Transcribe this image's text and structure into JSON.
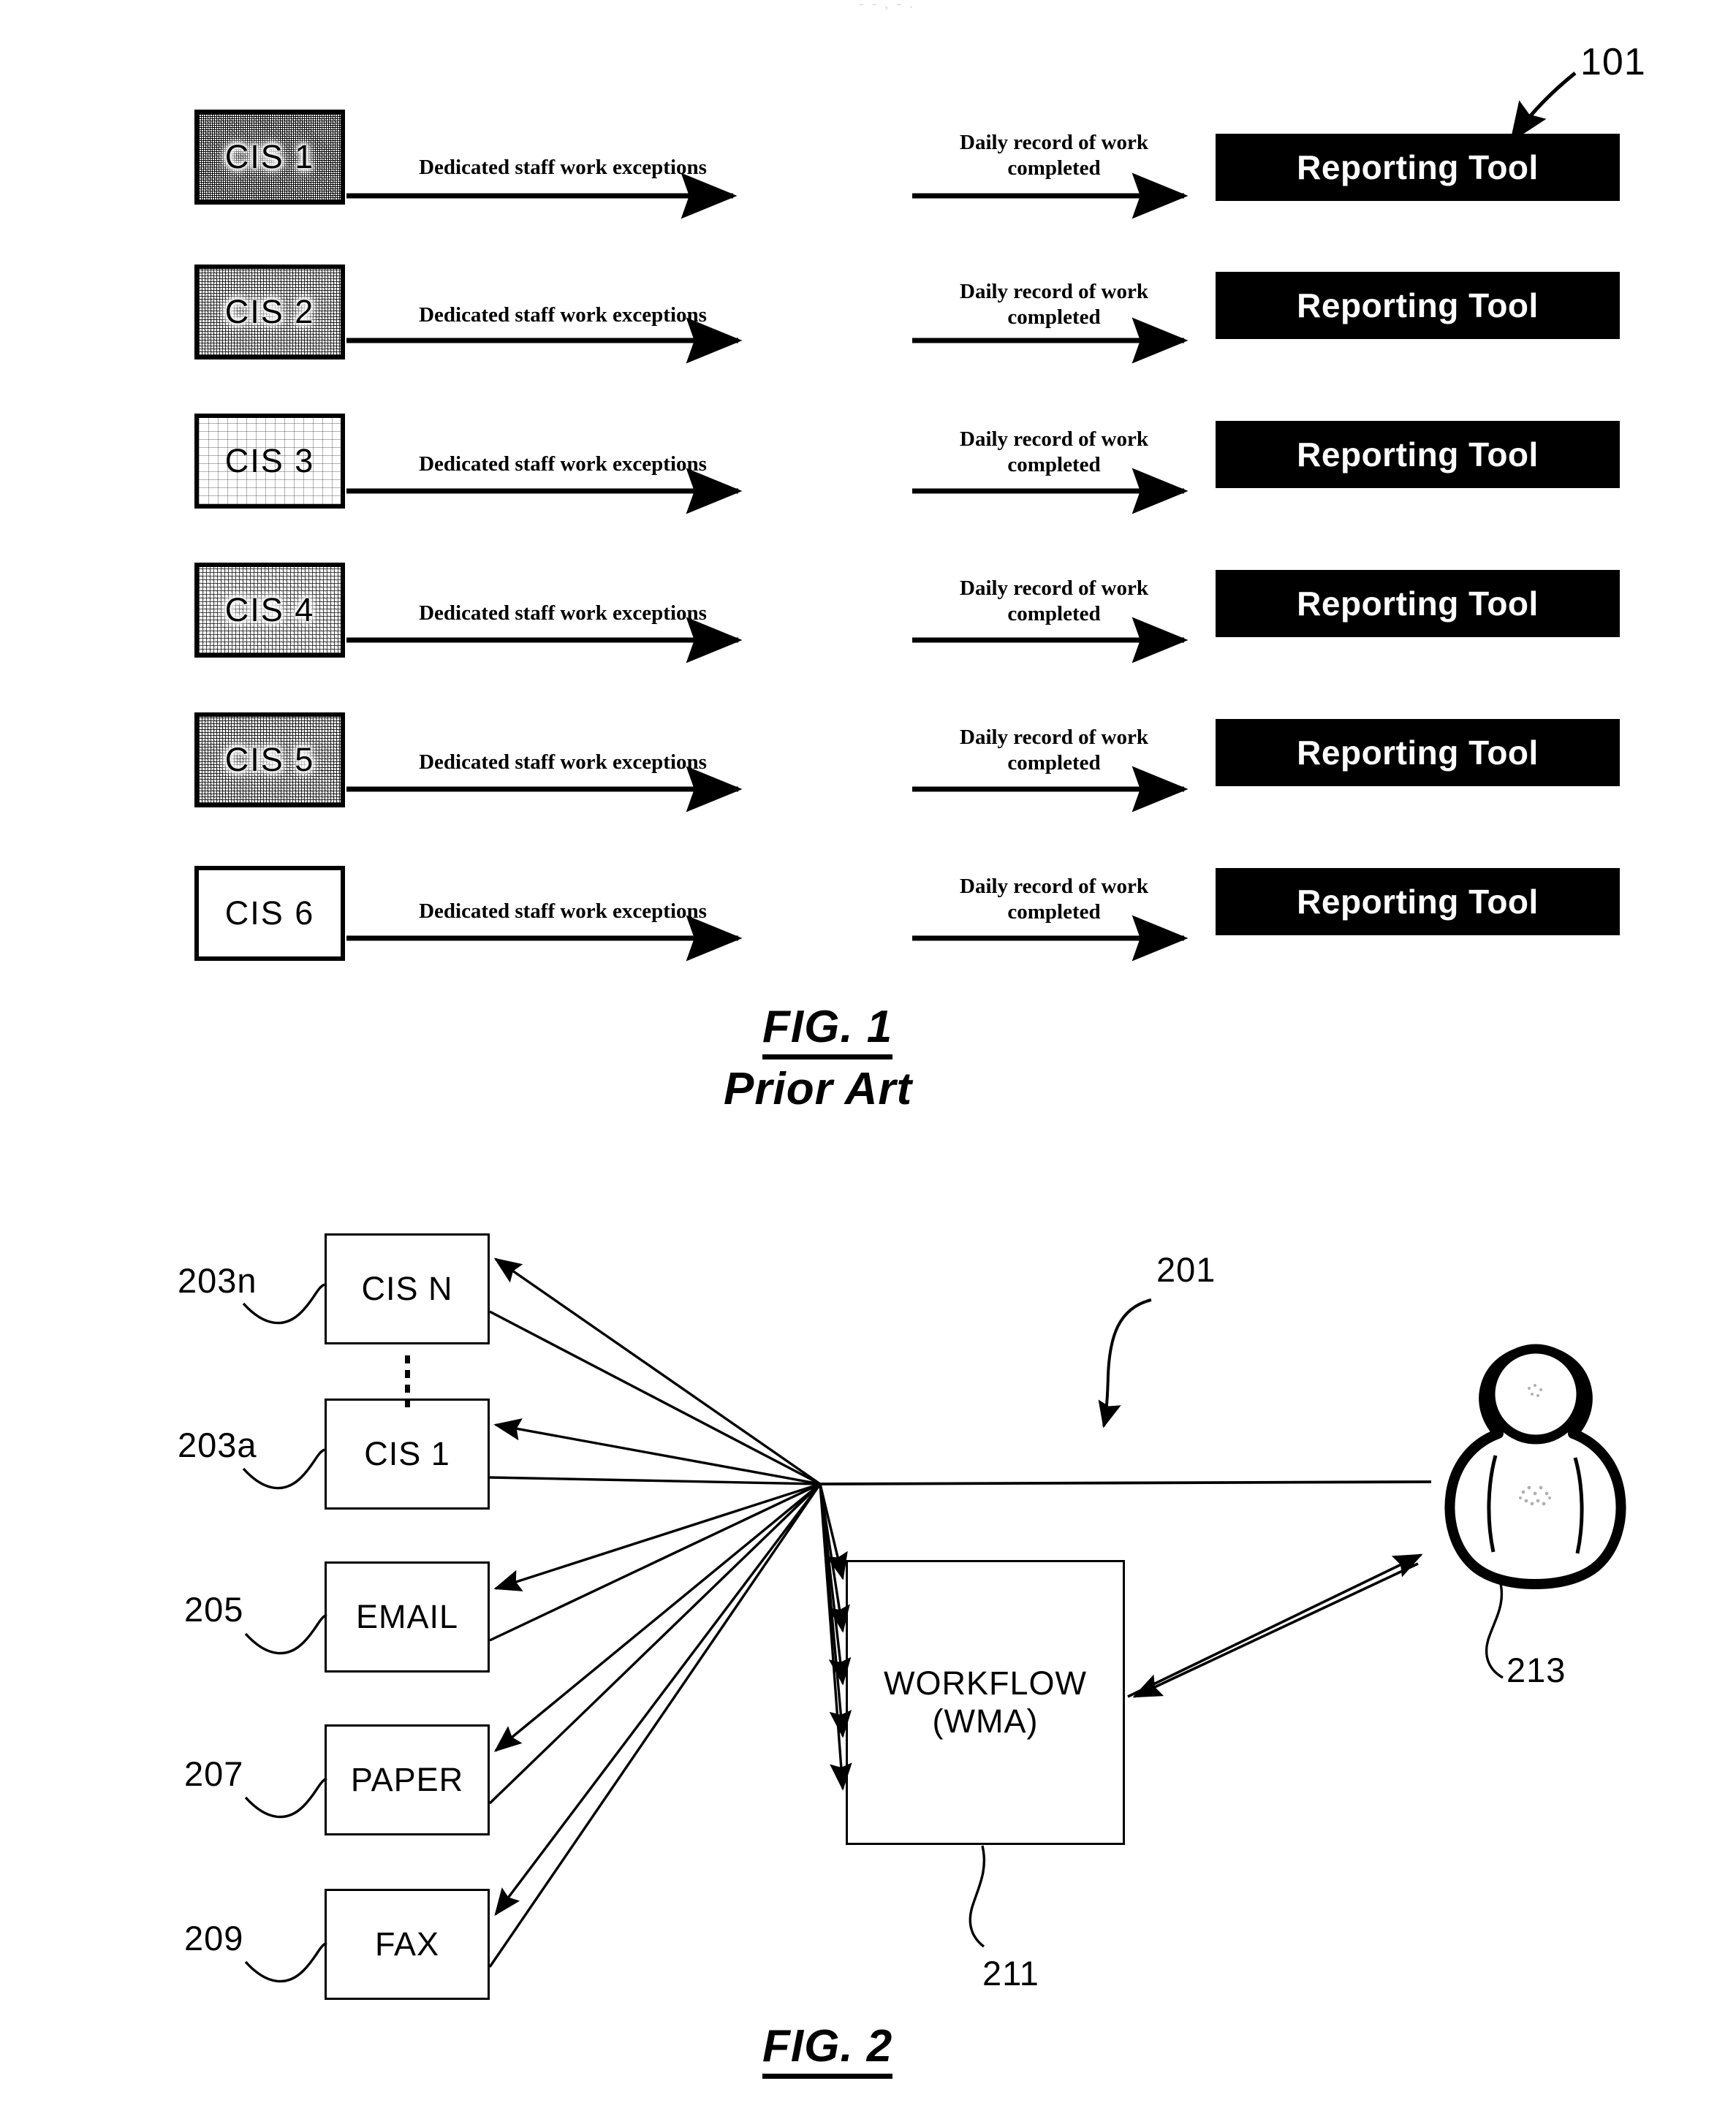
{
  "page": {
    "header_mark": "- - , - ."
  },
  "figures": [
    {
      "id": "fig1",
      "caption": "FIG. 1",
      "subcaption": "Prior Art",
      "ref_label": "101",
      "flow_label_left": "Dedicated staff work exceptions",
      "flow_label_right_line1": "Daily record of work",
      "flow_label_right_line2": "completed",
      "target_label": "Reporting Tool",
      "rows": [
        {
          "source": "CIS 1",
          "shade": "d1",
          "shade_pct": 55
        },
        {
          "source": "CIS 2",
          "shade": "d2",
          "shade_pct": 38
        },
        {
          "source": "CIS 3",
          "shade": "d3",
          "shade_pct": 5
        },
        {
          "source": "CIS 4",
          "shade": "d4",
          "shade_pct": 28
        },
        {
          "source": "CIS 5",
          "shade": "d5",
          "shade_pct": 40
        },
        {
          "source": "CIS 6",
          "shade": "d6",
          "shade_pct": 0
        }
      ],
      "actor_icon": "clerk-at-computer-icon"
    },
    {
      "id": "fig2",
      "caption": "FIG. 2",
      "ref_label": "201",
      "sources": [
        {
          "label": "CIS N",
          "ref": "203n"
        },
        {
          "label": "CIS 1",
          "ref": "203a"
        },
        {
          "label": "EMAIL",
          "ref": "205"
        },
        {
          "label": "PAPER",
          "ref": "207"
        },
        {
          "label": "FAX",
          "ref": "209"
        }
      ],
      "ellipsis_icon": "vertical-ellipsis-icon",
      "hub": {
        "workflow_line1": "WORKFLOW",
        "workflow_line2": "(WMA)",
        "workflow_ref": "211"
      },
      "user": {
        "icon": "person-icon",
        "ref": "213"
      }
    }
  ],
  "colors": {
    "ink": "#000000",
    "paper": "#ffffff",
    "target_fill": "#000000",
    "target_text": "#ffffff"
  }
}
